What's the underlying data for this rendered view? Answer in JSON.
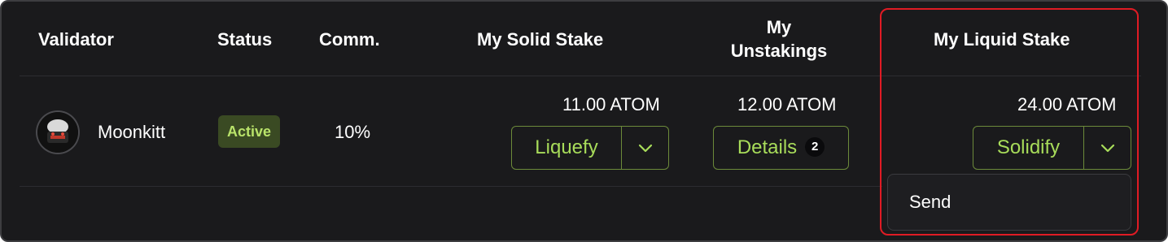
{
  "table": {
    "headers": {
      "validator": "Validator",
      "status": "Status",
      "commission": "Comm.",
      "solid_stake": "My Solid Stake",
      "unstakings_line1": "My",
      "unstakings_line2": "Unstakings",
      "liquid_stake": "My Liquid Stake"
    },
    "rows": [
      {
        "validator_name": "Moonkitt",
        "avatar_icon": "validator-avatar-icon",
        "status": "Active",
        "commission": "10%",
        "solid_stake": "11.00 ATOM",
        "unstakings": "12.00 ATOM",
        "liquid_stake": "24.00 ATOM"
      }
    ]
  },
  "actions": {
    "liquefy_label": "Liquefy",
    "details_label": "Details",
    "details_count": "2",
    "solidify_label": "Solidify",
    "dropdown_icon": "chevron-down-icon"
  },
  "dropdown_menu": {
    "items": [
      "Send"
    ]
  },
  "colors": {
    "background": "#1a1a1c",
    "accent_green": "#a8dc5a",
    "button_border": "#6c8a3a",
    "badge_bg": "#3a4a23",
    "badge_text": "#b9e36a",
    "highlight_red": "#e01b24"
  }
}
